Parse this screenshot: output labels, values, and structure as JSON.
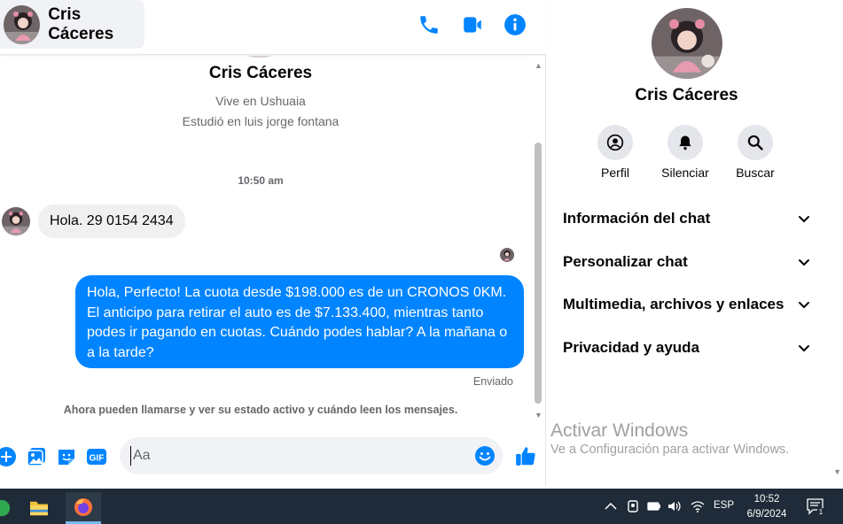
{
  "header": {
    "contact_name": "Cris Cáceres",
    "icons": [
      "phone-icon",
      "video-icon",
      "info-icon"
    ]
  },
  "conversation": {
    "profile_name": "Cris Cáceres",
    "profile_location": "Vive en Ushuaia",
    "profile_education": "Estudió en luis jorge fontana",
    "time_separator": "10:50 am",
    "incoming_message": "Hola.  29 0154 2434",
    "outgoing_message": "Hola, Perfecto! La cuota desde $198.000 es de un CRONOS 0KM. El anticipo para retirar el auto es de $7.133.400, mientras tanto podes ir pagando en cuotas. Cuándo podes hablar? A la mañana o a la tarde?",
    "sent_status": "Enviado",
    "notice": "Ahora pueden llamarse y ver su estado activo y cuándo leen los mensajes."
  },
  "composer": {
    "placeholder": "Aa",
    "icons": [
      "add-icon",
      "image-icon",
      "sticker-icon",
      "gif-icon",
      "emoji-icon",
      "thumbs-up-icon"
    ],
    "gif_label": "GIF"
  },
  "info_panel": {
    "name": "Cris Cáceres",
    "actions": [
      {
        "label": "Perfil",
        "icon": "profile-icon"
      },
      {
        "label": "Silenciar",
        "icon": "bell-icon"
      },
      {
        "label": "Buscar",
        "icon": "search-icon"
      }
    ],
    "sections": [
      {
        "label": "Información del chat"
      },
      {
        "label": "Personalizar chat"
      },
      {
        "label": "Multimedia, archivos y enlaces"
      },
      {
        "label": "Privacidad y ayuda"
      }
    ]
  },
  "watermark": {
    "title": "Activar Windows",
    "subtitle": "Ve a Configuración para activar Windows."
  },
  "taskbar": {
    "language": "ESP",
    "time": "10:52",
    "date": "6/9/2024",
    "notification_count": "1"
  },
  "colors": {
    "accent": "#0084ff",
    "taskbar": "#1f2b38"
  }
}
